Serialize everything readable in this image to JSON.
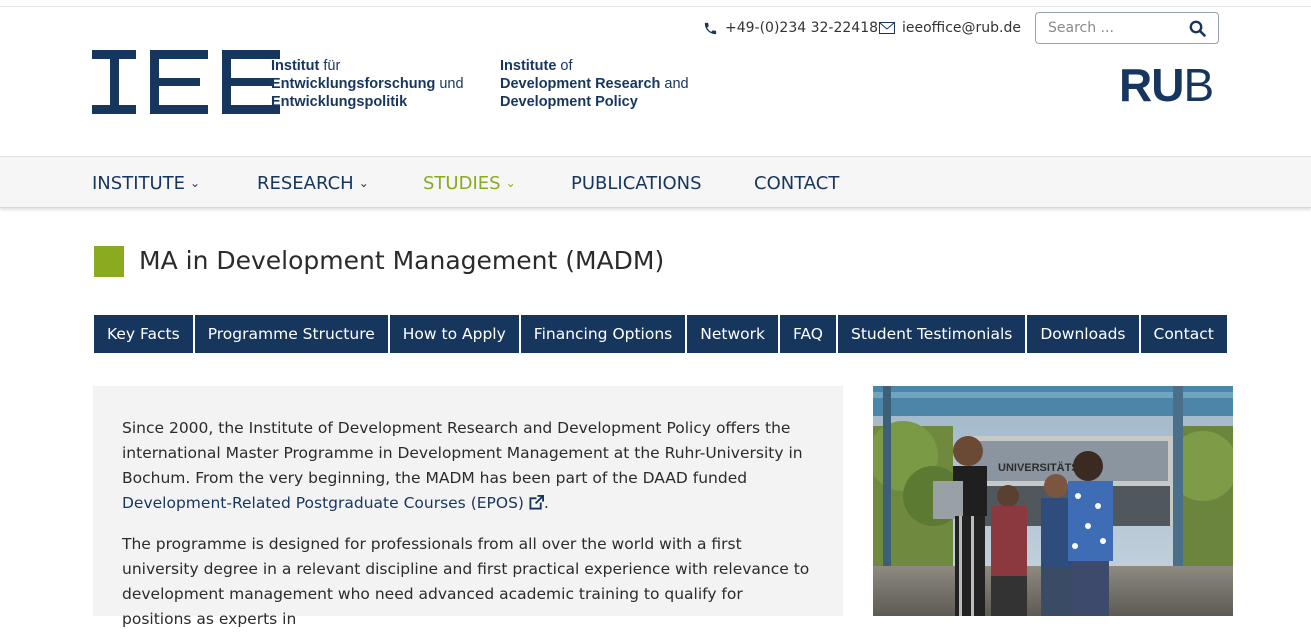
{
  "header": {
    "logo_text": "IEE",
    "institute_de": {
      "line1_bold": "Institut",
      "line1_rest": " für",
      "line2_bold": "Entwicklungsforschung",
      "line2_rest": " und",
      "line3_bold": "Entwicklungspolitik"
    },
    "institute_en": {
      "line1_bold": "Institute",
      "line1_rest": " of",
      "line2_bold": "Development Research",
      "line2_rest": " and",
      "line3_bold": "Development Policy"
    },
    "phone": "+49-(0)234 32-22418",
    "email": "ieeoffice@rub.de",
    "search_placeholder": "Search ...",
    "rub_logo": {
      "bold": "RU",
      "regular": "B"
    }
  },
  "nav": {
    "items": [
      {
        "label": "INSTITUTE",
        "has_dropdown": true,
        "active": false
      },
      {
        "label": "RESEARCH",
        "has_dropdown": true,
        "active": false
      },
      {
        "label": "STUDIES",
        "has_dropdown": true,
        "active": true
      },
      {
        "label": "PUBLICATIONS",
        "has_dropdown": false,
        "active": false
      },
      {
        "label": "CONTACT",
        "has_dropdown": false,
        "active": false
      }
    ],
    "chevron": "⌄"
  },
  "page": {
    "title": "MA in Development Management (MADM)"
  },
  "tabs": [
    "Key Facts",
    "Programme Structure",
    "How to Apply",
    "Financing Options",
    "Network",
    "FAQ",
    "Student Testimonials",
    "Downloads",
    "Contact"
  ],
  "content": {
    "p1_text": "Since 2000, the Institute of Development Research and Development Policy offers the international Master Programme in Development Management at the Ruhr-University in Bochum. From the very beginning, the MADM has been part of the DAAD funded ",
    "p1_link": "Development-Related Postgraduate Courses (EPOS)",
    "p1_end": ".",
    "p2_text": "The programme is designed for professionals from all over the world with a first university degree in a relevant discipline and first practical experience with relevance to development management who need advanced academic training to qualify for positions as experts in"
  },
  "photo": {
    "sign_text": "UNIVERSITÄTS"
  },
  "colors": {
    "brand_blue": "#17365d",
    "accent_green": "#8aaa1f",
    "content_bg": "#f3f3f3"
  }
}
